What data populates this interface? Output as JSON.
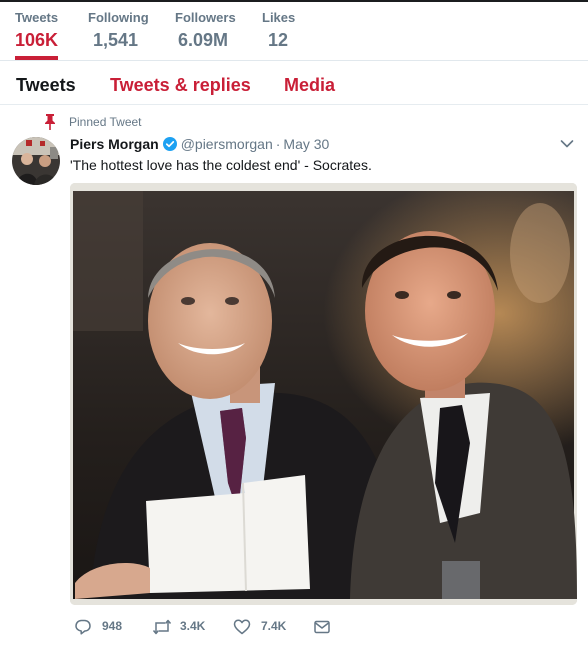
{
  "profile_nav": {
    "stats": [
      {
        "label": "Tweets",
        "value": "106K",
        "active": true
      },
      {
        "label": "Following",
        "value": "1,541"
      },
      {
        "label": "Followers",
        "value": "6.09M"
      },
      {
        "label": "Likes",
        "value": "12"
      }
    ]
  },
  "tabs": {
    "tweets": "Tweets",
    "replies": "Tweets & replies",
    "media": "Media"
  },
  "tweet": {
    "pinned_label": "Pinned Tweet",
    "author_name": "Piers Morgan",
    "author_handle": "@piersmorgan",
    "separator": "·",
    "date": "May 30",
    "text": "'The hottest love has the coldest end' - Socrates.",
    "actions": {
      "replies": "948",
      "retweets": "3.4K",
      "likes": "7.4K"
    }
  },
  "colors": {
    "accent": "#c91f37",
    "muted": "#657786",
    "verified": "#1da1f2"
  },
  "icons": [
    "pin-icon",
    "verified-badge-icon",
    "chevron-down-icon",
    "reply-icon",
    "retweet-icon",
    "heart-icon",
    "direct-message-icon"
  ]
}
